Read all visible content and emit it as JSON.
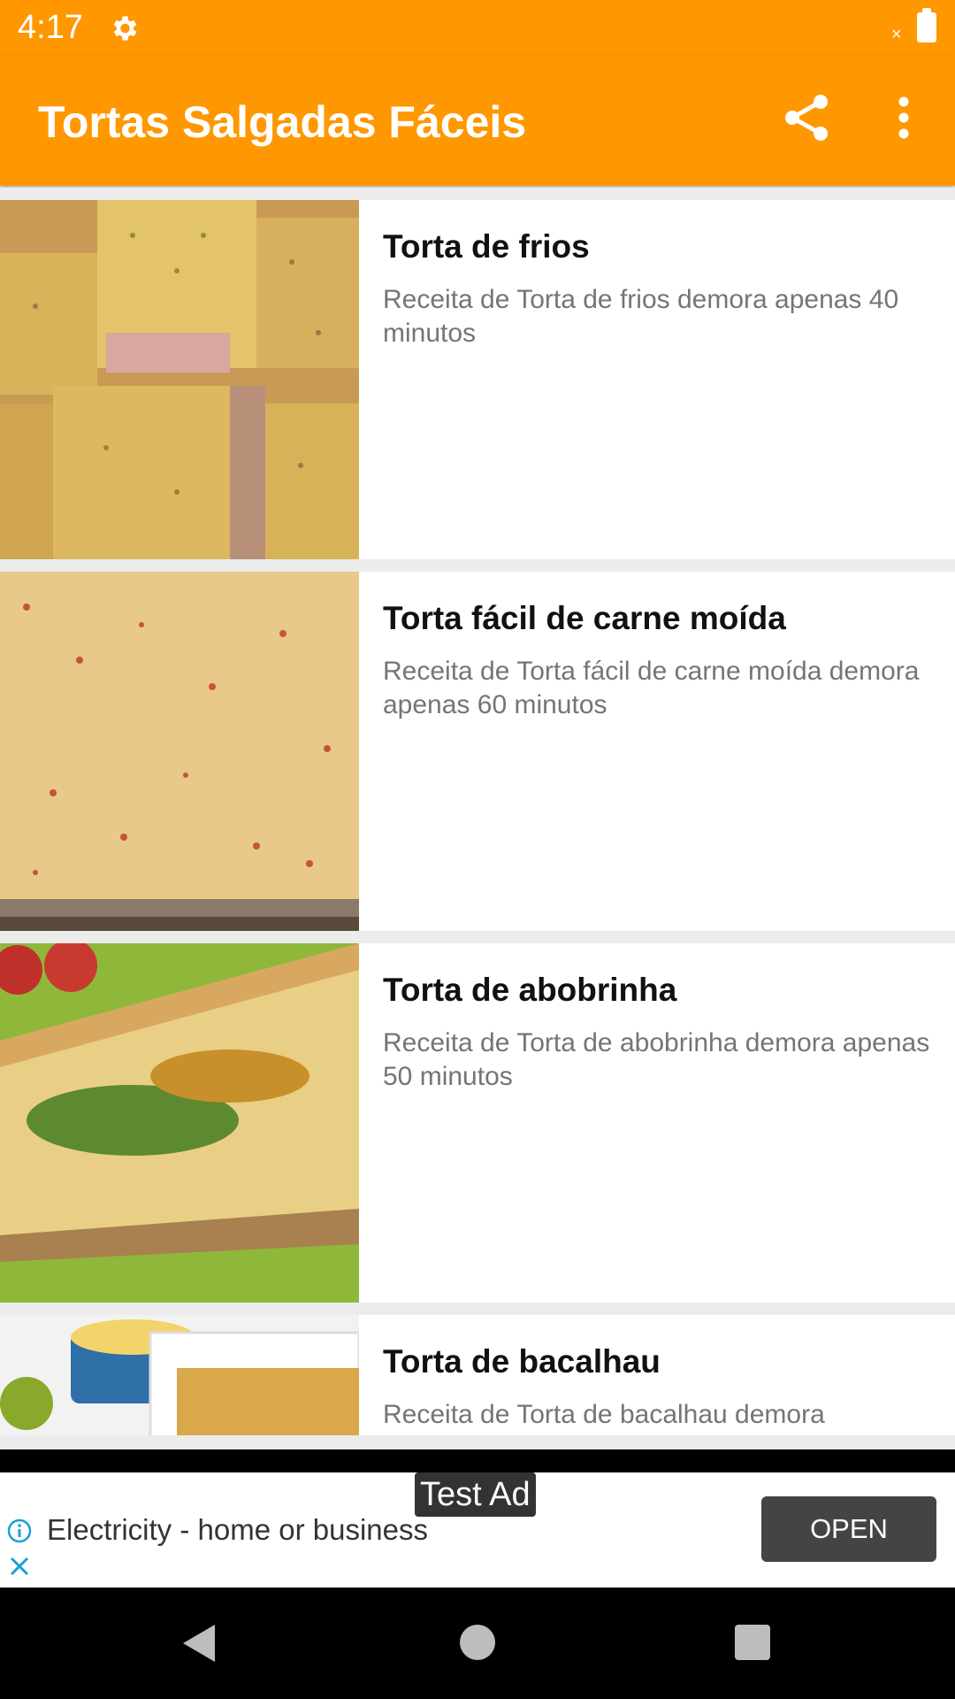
{
  "status_bar": {
    "time": "4:17"
  },
  "app_bar": {
    "title": "Tortas Salgadas Fáceis"
  },
  "recipes": [
    {
      "title": "Torta de frios",
      "description": "Receita de Torta de frios demora apenas 40 minutos"
    },
    {
      "title": "Torta fácil de carne moída",
      "description": "Receita de Torta fácil de carne moída demora apenas 60 minutos"
    },
    {
      "title": "Torta de abobrinha",
      "description": "Receita de Torta de abobrinha demora apenas 50 minutos"
    },
    {
      "title": "Torta de bacalhau",
      "description": "Receita de Torta de bacalhau demora"
    }
  ],
  "ad": {
    "label": "Test Ad",
    "text": "Electricity - home or business",
    "button": "OPEN"
  },
  "colors": {
    "primary": "#ff9800",
    "ad_button": "#444444"
  }
}
